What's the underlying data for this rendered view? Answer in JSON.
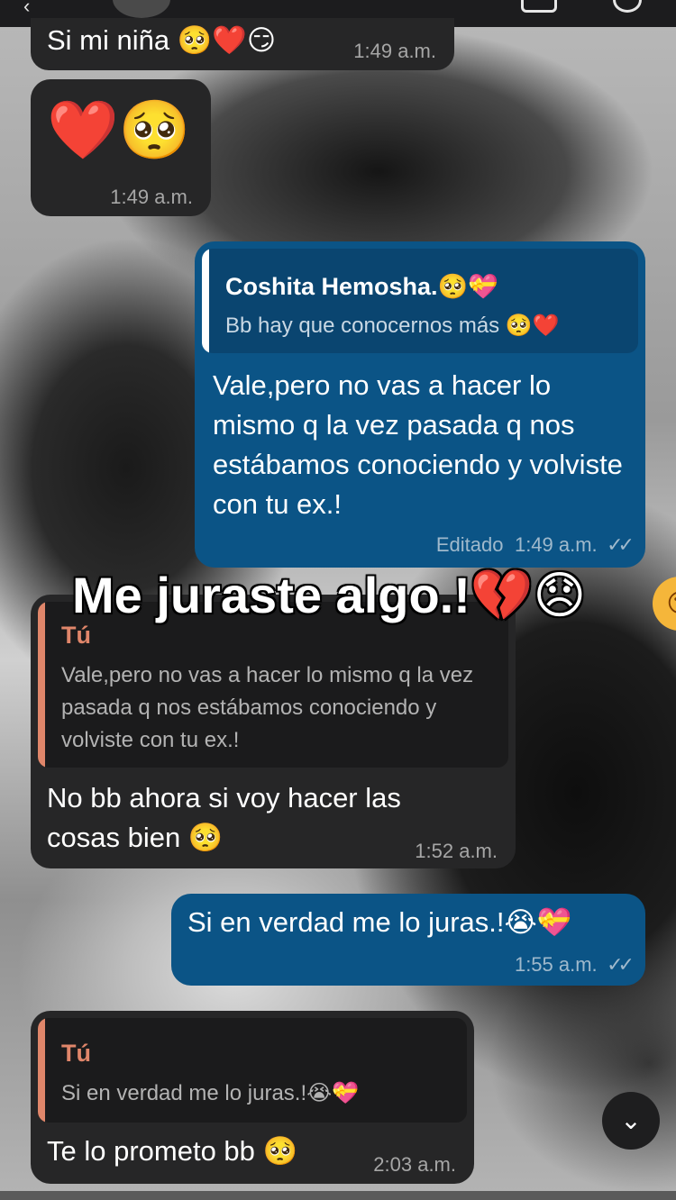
{
  "messages": [
    {
      "id": "m1",
      "direction": "incoming",
      "text": "Si mi niña 🥺❤️😏",
      "time": "1:49 a.m."
    },
    {
      "id": "m2",
      "direction": "incoming",
      "text": "❤️🥺",
      "time": "1:49 a.m."
    },
    {
      "id": "m3",
      "direction": "outgoing",
      "reply_to": {
        "author": "Coshita Hemosha.🥺💝",
        "text": "Bb hay que conocernos más 🥺❤️"
      },
      "text": "Vale,pero no vas a hacer lo mismo q la vez pasada q nos estábamos conociendo y volviste con tu ex.!",
      "edited_label": "Editado",
      "time": "1:49 a.m.",
      "status": "read"
    },
    {
      "id": "m4",
      "direction": "incoming",
      "reply_to": {
        "author": "Tú",
        "text": "Vale,pero no vas a hacer lo mismo q la vez pasada q nos estábamos conociendo y volviste con tu ex.!"
      },
      "text": "No bb ahora si voy hacer las cosas bien 🥺",
      "time": "1:52 a.m."
    },
    {
      "id": "m5",
      "direction": "outgoing",
      "text": "Si en verdad me lo juras.!😭💝",
      "time": "1:55 a.m.",
      "status": "read"
    },
    {
      "id": "m6",
      "direction": "incoming",
      "reply_to": {
        "author": "Tú",
        "text": "Si en verdad me lo juras.!😭💝"
      },
      "text": "Te lo prometo bb 🥺",
      "time": "2:03 a.m."
    }
  ],
  "overlay_caption": "Me juraste algo.!💔😞",
  "icons": {
    "read_ticks": "✓✓",
    "scroll_down": "⌄",
    "back": "‹"
  },
  "colors": {
    "incoming_bubble": "#262627",
    "outgoing_bubble": "#0b5486",
    "reply_accent": "#e0866a"
  }
}
